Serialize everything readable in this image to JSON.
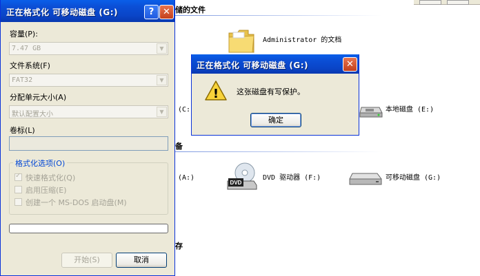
{
  "explorer": {
    "group_stored_files_partial": "储的文件",
    "group_devices_partial": "备",
    "group_other_partial": "存",
    "items": {
      "admin_docs": "Administrator 的文档",
      "drive_c_partial": "(C:)",
      "local_disk_e": "本地磁盘 (E:)",
      "drive_a_partial": "(A:)",
      "dvd_drive": "DVD 驱动器 (F:)",
      "dvd_badge": "DVD",
      "removable_g": "可移动磁盘 (G:)"
    }
  },
  "format_dialog": {
    "title": "正在格式化 可移动磁盘 (G:)",
    "help_glyph": "?",
    "close_glyph": "✕",
    "capacity_label": "容量(P):",
    "capacity_value": "7.47 GB",
    "filesystem_label": "文件系统(F)",
    "filesystem_value": "FAT32",
    "alloc_label": "分配单元大小(A)",
    "alloc_value": "默认配置大小",
    "volume_label": "卷标(L)",
    "volume_value": "",
    "options_title": "格式化选项(O)",
    "opt_quick": "快速格式化(Q)",
    "opt_quick_checked": true,
    "opt_compress": "启用压缩(E)",
    "opt_msdos": "创建一个 MS-DOS 启动盘(M)",
    "progress_percent": 0,
    "start_button": "开始(S)",
    "cancel_button": "取消"
  },
  "message_box": {
    "title": "正在格式化 可移动磁盘 (G:)",
    "close_glyph": "✕",
    "message": "这张磁盘有写保护。",
    "ok_button": "确定",
    "warning_glyph": "!"
  },
  "colors": {
    "titlebar_blue": "#0a4fd6",
    "dialog_bg": "#ece9d8",
    "group_title": "#0046d5",
    "close_red": "#d5542b",
    "warning_yellow": "#f8d33a"
  }
}
